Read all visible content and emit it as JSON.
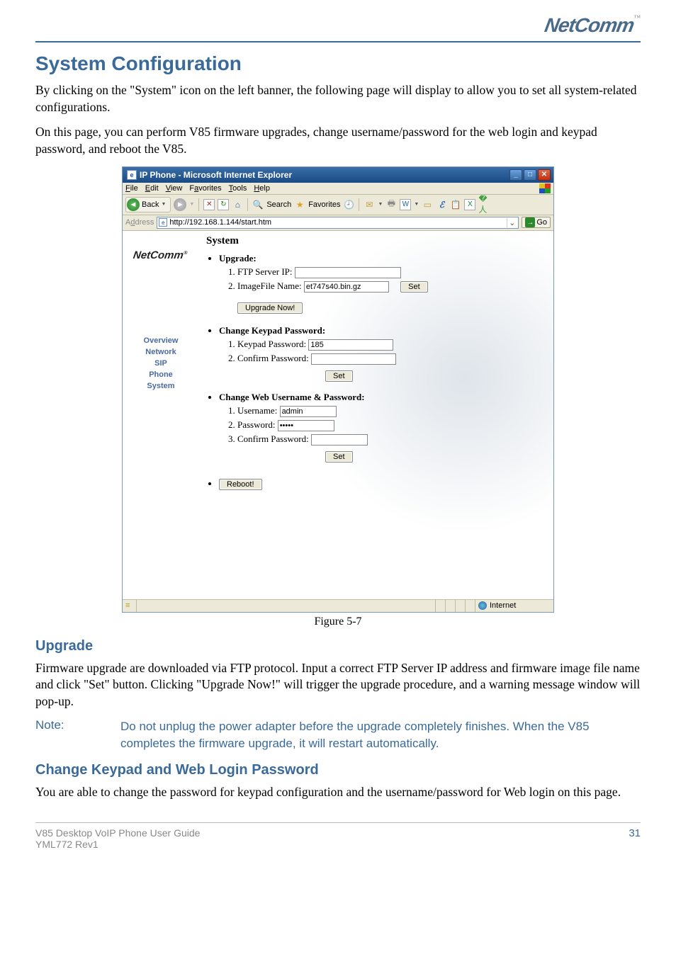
{
  "brand": {
    "name": "NetComm",
    "tm": "™",
    "reg": "®"
  },
  "page": {
    "h1": "System Configuration",
    "p1": "By clicking on the \"System\" icon on the left banner, the following page will display to allow you to set all system-related configurations.",
    "p2": "On this page, you can perform V85 firmware upgrades, change username/password for the web login and keypad password, and reboot the V85.",
    "figcaption": "Figure 5-7",
    "h2_upgrade": "Upgrade",
    "p_upgrade": "Firmware upgrade are downloaded via FTP protocol. Input a correct FTP Server IP address and firmware image file name and click \"Set\" button. Clicking \"Upgrade Now!\" will trigger the upgrade procedure, and a warning message window will pop-up.",
    "note_label": "Note:",
    "note_body": "Do not unplug the power adapter before the upgrade completely finishes. When the V85 completes the firmware upgrade, it will restart automatically.",
    "h2_pw": "Change Keypad and Web Login Password",
    "p_pw": "You are able to change the password for keypad configuration and the username/password for Web login on this page."
  },
  "ie": {
    "title": "IP Phone - Microsoft Internet Explorer",
    "menus": {
      "file": "File",
      "edit": "Edit",
      "view": "View",
      "fav": "Favorites",
      "tools": "Tools",
      "help": "Help"
    },
    "toolbar": {
      "back": "Back",
      "search": "Search",
      "favorites": "Favorites"
    },
    "address_label": "Address",
    "address_value": "http://192.168.1.144/start.htm",
    "go": "Go",
    "left_nav": {
      "overview": "Overview",
      "network": "Network",
      "sip": "SIP",
      "phone": "Phone",
      "system": "System"
    },
    "content": {
      "heading": "System",
      "upgrade_title": "Upgrade:",
      "ftp_label": "FTP Server IP:",
      "ftp_value": "",
      "image_label": "ImageFile Name:",
      "image_value": "et747s40.bin.gz",
      "set": "Set",
      "upgrade_now": "Upgrade Now!",
      "kp_title": "Change Keypad Password:",
      "kp_label": "Keypad Password:",
      "kp_value": "185",
      "kp_confirm": "Confirm Password:",
      "web_title": "Change Web Username & Password:",
      "user_label": "Username:",
      "user_value": "admin",
      "pass_label": "Password:",
      "pass_value": "•••••",
      "confirm_label": "Confirm Password:",
      "reboot": "Reboot!"
    },
    "status": {
      "zone": "Internet"
    }
  },
  "footer": {
    "line1": "V85 Desktop VoIP Phone User Guide",
    "line2": "YML772 Rev1",
    "page_no": "31"
  }
}
